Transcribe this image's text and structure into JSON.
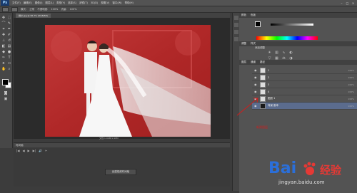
{
  "app": {
    "name": "Ps"
  },
  "menu": {
    "items": [
      "文件(F)",
      "编辑(E)",
      "图像(I)",
      "图层(L)",
      "类型(Y)",
      "选择(S)",
      "滤镜(T)",
      "3D(D)",
      "视图(V)",
      "窗口(W)",
      "帮助(H)"
    ]
  },
  "window_controls": [
    "–",
    "□",
    "×"
  ],
  "options_bar": {
    "mode": "模式:",
    "mode_value": "正常",
    "opacity": "不透明度:",
    "opacity_value": "100%",
    "flow": "流量:",
    "flow_value": "100%"
  },
  "document": {
    "tab_label": "婚纱.jpg @ 66.7% (RGB/8#)",
    "status": "文档:1.99M/1.99M"
  },
  "timeline": {
    "title": "时间轴",
    "create_video_label": "创建视频时间轴",
    "controls": [
      "|◀",
      "◀",
      "▶",
      "▶|",
      "🔊",
      "✂"
    ]
  },
  "panels": {
    "color_tabs": [
      "颜色",
      "色板"
    ],
    "adjust_tabs": [
      "调整",
      "样式"
    ],
    "adjust_title": "添加调整",
    "layers_tabs": [
      "图层",
      "通道",
      "路径"
    ],
    "layers": [
      {
        "name": "1",
        "opacity": "100%",
        "active": false
      },
      {
        "name": "2",
        "opacity": "100%",
        "active": false
      },
      {
        "name": "3",
        "opacity": "100%",
        "active": false
      },
      {
        "name": "4",
        "opacity": "100%",
        "active": false
      },
      {
        "name": "图层 1",
        "opacity": "100%",
        "active": false
      },
      {
        "name": "背景 副本",
        "opacity": "100%",
        "active": true
      }
    ],
    "annotation_label": "新建图层"
  },
  "colors": {
    "foreground": "#000000",
    "background": "#ffffff",
    "photo_bg": "#b52b2b",
    "annotation": "#d31c1c",
    "active_layer": "#5b6c8e"
  },
  "watermark": {
    "brand_left": "Bai",
    "brand_right": "经验",
    "site": "jingyan.baidu.com"
  }
}
